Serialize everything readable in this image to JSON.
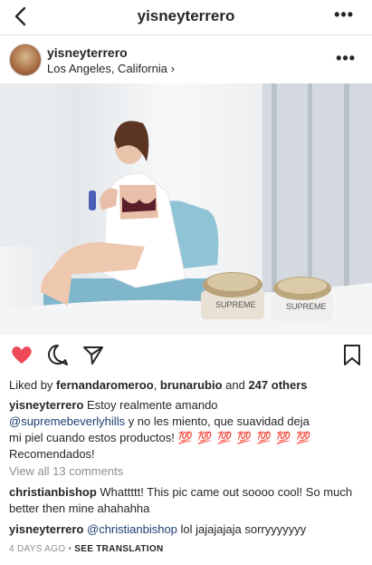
{
  "header": {
    "title": "yisneyterrero"
  },
  "post": {
    "username": "yisneyterrero",
    "location": "Los Angeles, California",
    "photo": {
      "brand_text_left": "SUPREME",
      "brand_text_right": "SUPREME"
    },
    "likes": {
      "prefix": "Liked by ",
      "user1": "fernandaromeroo",
      "sep": ", ",
      "user2": "brunarubio",
      "and": " and ",
      "others": "247 others"
    },
    "caption": {
      "user": "yisneyterrero",
      "line1": " Estoy realmente amando",
      "mention": "@supremebeverlyhills",
      "line2": " y no les miento, que suavidad deja",
      "line3": "mi piel cuando estos productos! ",
      "emoji": "💯 💯 💯 💯 💯 💯 💯",
      "line4": "Recomendados!"
    },
    "view_comments": "View all 13 comments",
    "comments": [
      {
        "user": "christianbishop",
        "text": " Whattttt! This pic came out soooo cool! So much better then mine ahahahha"
      },
      {
        "user": "yisneyterrero",
        "mention": " @christianbishop",
        "text": " lol jajajajaja sorryyyyyyy"
      }
    ],
    "time": "4 DAYS AGO",
    "dot": " • ",
    "translation": "SEE TRANSLATION"
  }
}
